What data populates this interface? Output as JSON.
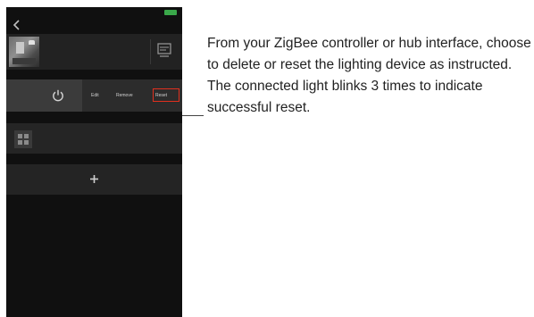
{
  "phone": {
    "status_bar": {
      "carrier": "",
      "time": "",
      "battery": ""
    },
    "header": {
      "room_title": ""
    },
    "room_card": {
      "name": ""
    },
    "sections": {
      "lights": "",
      "devices": "",
      "scenes": ""
    },
    "light_control": {
      "edit_label": "Edit",
      "remove_label": "Remove",
      "reset_label": "Reset"
    },
    "device": {
      "name": "",
      "subtitle": ""
    },
    "highlight_color": "#e0301e"
  },
  "instruction": {
    "text": "From your ZigBee controller or hub interface, choose to delete or reset the lighting device as instructed. The connected light blinks 3 times to indicate successful reset."
  }
}
